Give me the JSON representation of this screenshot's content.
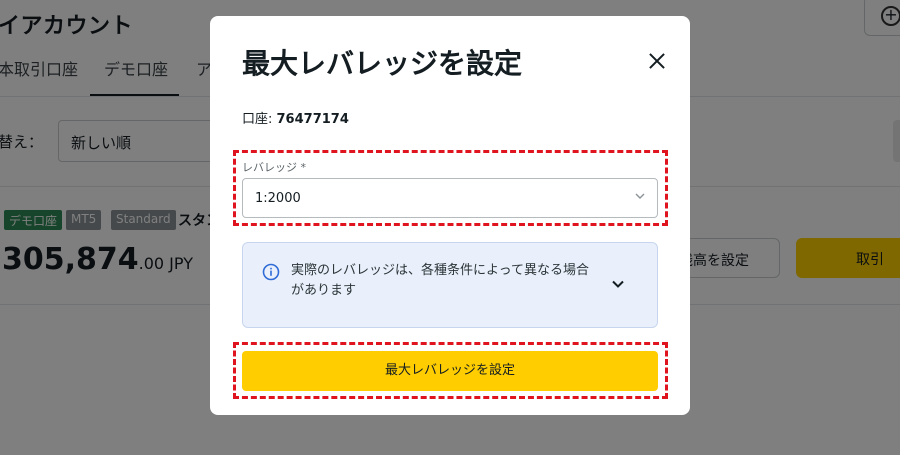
{
  "background": {
    "title": "イアカウント",
    "add_icon": "plus-circle-icon",
    "tabs": [
      {
        "label": "本取引口座"
      },
      {
        "label": "デモ口座"
      },
      {
        "label": "ア"
      }
    ],
    "sort_label": "替え：",
    "sort_value": "新しい順",
    "account": {
      "badges": [
        "デモ口座",
        "MT5",
        "Standard"
      ],
      "type_name": "スタン",
      "balance_int": "305,874",
      "balance_dec": ".00 JPY",
      "set_balance_label": "残高を設定",
      "trade_label": "取引"
    }
  },
  "modal": {
    "title": "最大レバレッジを設定",
    "close_icon": "close-icon",
    "account_prefix": "口座: ",
    "account_number": "76477174",
    "leverage_label": "レバレッジ *",
    "leverage_value": "1:2000",
    "info_icon": "info-icon",
    "info_text": "実際のレバレッジは、各種条件によって異なる場合があります",
    "submit_label": "最大レバレッジを設定"
  },
  "colors": {
    "accent_yellow": "#ffcd00",
    "highlight_red": "#e0141e",
    "info_bg": "#e9f0fb",
    "demo_badge": "#2e8b57"
  }
}
